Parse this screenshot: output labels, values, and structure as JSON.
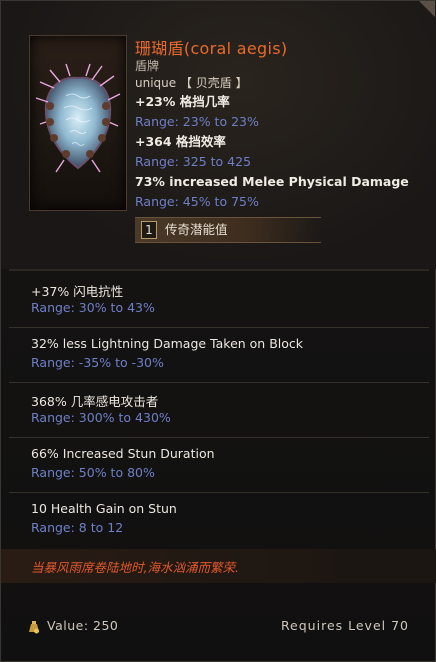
{
  "item": {
    "name": "珊瑚盾(coral aegis)",
    "type": "盾牌",
    "rarity": "unique 【 贝壳盾 】",
    "icon": "coral-shield-icon"
  },
  "implicits": [
    {
      "stat": "+23% 格挡几率",
      "range": "Range: 23% to 23%"
    },
    {
      "stat": "+364 格挡效率",
      "range": "Range: 325 to 425"
    },
    {
      "stat": "73% increased Melee Physical Damage",
      "range": "Range: 45% to 75%"
    }
  ],
  "legendary": {
    "count": "1",
    "label": "传奇潜能值"
  },
  "affixes": [
    {
      "stat": "+37% 闪电抗性",
      "range": "Range: 30% to 43%"
    },
    {
      "stat": "32% less Lightning Damage Taken on Block",
      "range": "Range: -35% to -30%"
    },
    {
      "stat": "368% 几率感电攻击者",
      "range": "Range: 300% to 430%"
    },
    {
      "stat": "66% Increased Stun Duration",
      "range": "Range: 50% to 80%"
    },
    {
      "stat": "10 Health Gain on Stun",
      "range": "Range: 8 to 12"
    }
  ],
  "flavor": "当暴风雨席卷陆地时,海水汹涌而繁荣.",
  "footer": {
    "value": "Value: 250",
    "requires": "Requires Level 70"
  },
  "colors": {
    "title": "#e96a2a",
    "range": "#6f7fc7",
    "flavor": "#e0592a"
  }
}
